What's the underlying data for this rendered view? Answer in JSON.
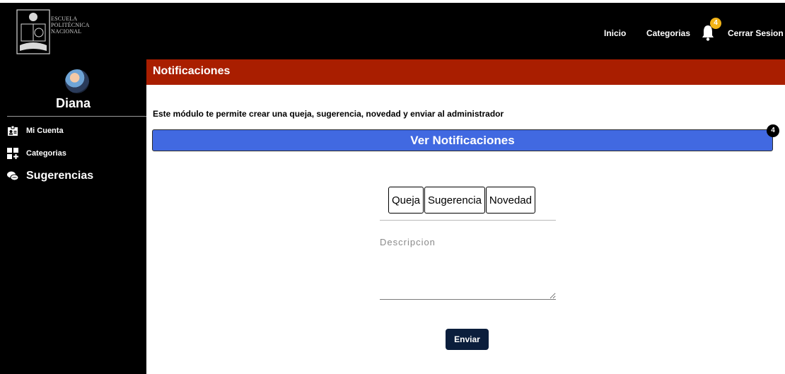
{
  "header": {
    "logo_text": [
      "ESCUELA",
      "POLITÉCNICA",
      "NACIONAL"
    ],
    "nav": {
      "inicio": "Inicio",
      "categorias": "Categorias",
      "logout": "Cerrar Sesion"
    },
    "bell_badge": "4",
    "bell_icon": "bell-icon"
  },
  "sidebar": {
    "username": "Diana",
    "items": [
      {
        "label": "Mi Cuenta",
        "icon": "id-card-icon"
      },
      {
        "label": "Categorias",
        "icon": "grid-plus-icon"
      },
      {
        "label": "Sugerencias",
        "icon": "chat-bubbles-icon"
      }
    ]
  },
  "main": {
    "title": "Notificaciones",
    "intro": "Este módulo te permite crear una queja, sugerencia, novedad y enviar al administrador",
    "ver_button": "Ver Notificaciones",
    "ver_badge": "4",
    "types": [
      "Queja",
      "Sugerencia",
      "Novedad"
    ],
    "description_placeholder": "Descripcion",
    "description_value": "",
    "submit": "Enviar"
  },
  "colors": {
    "topbar": "#000000",
    "header_bar": "#a91e00",
    "ver_button": "#4169e1",
    "submit": "#0b1e3c",
    "badge": "#f2b418"
  }
}
